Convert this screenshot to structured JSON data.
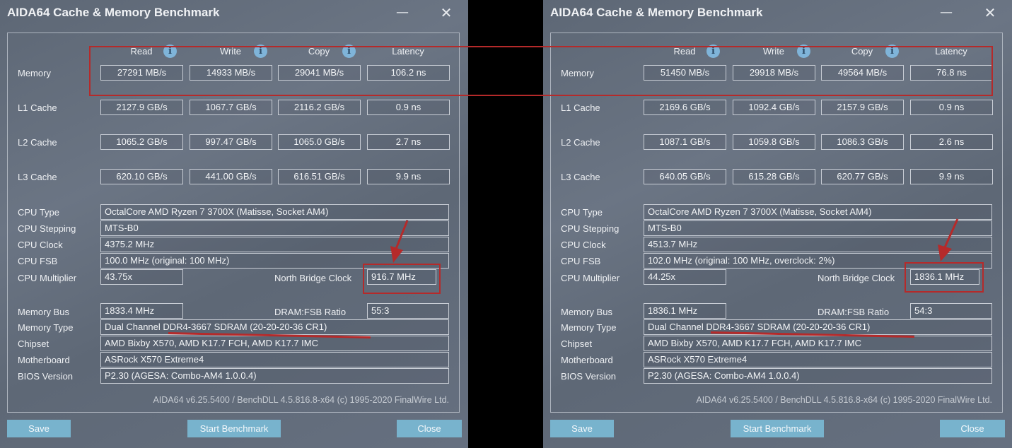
{
  "windows": [
    {
      "title": "AIDA64 Cache & Memory Benchmark",
      "headers": {
        "read": "Read",
        "write": "Write",
        "copy": "Copy",
        "latency": "Latency"
      },
      "rows": [
        {
          "label": "Memory",
          "read": "27291 MB/s",
          "write": "14933 MB/s",
          "copy": "29041 MB/s",
          "latency": "106.2 ns"
        },
        {
          "label": "L1 Cache",
          "read": "2127.9 GB/s",
          "write": "1067.7 GB/s",
          "copy": "2116.2 GB/s",
          "latency": "0.9 ns"
        },
        {
          "label": "L2 Cache",
          "read": "1065.2 GB/s",
          "write": "997.47 GB/s",
          "copy": "1065.0 GB/s",
          "latency": "2.7 ns"
        },
        {
          "label": "L3 Cache",
          "read": "620.10 GB/s",
          "write": "441.00 GB/s",
          "copy": "616.51 GB/s",
          "latency": "9.9 ns"
        }
      ],
      "cpu_type_label": "CPU Type",
      "cpu_type": "OctalCore AMD Ryzen 7 3700X  (Matisse, Socket AM4)",
      "cpu_stepping_label": "CPU Stepping",
      "cpu_stepping": "MTS-B0",
      "cpu_clock_label": "CPU Clock",
      "cpu_clock": "4375.2 MHz",
      "cpu_fsb_label": "CPU FSB",
      "cpu_fsb": "100.0 MHz  (original: 100 MHz)",
      "cpu_multiplier_label": "CPU Multiplier",
      "cpu_multiplier": "43.75x",
      "nb_clock_label": "North Bridge Clock",
      "nb_clock": "916.7 MHz",
      "memory_bus_label": "Memory Bus",
      "memory_bus": "1833.4 MHz",
      "dram_fsb_label": "DRAM:FSB Ratio",
      "dram_fsb": "55:3",
      "memory_type_label": "Memory Type",
      "memory_type": "Dual Channel DDR4-3667 SDRAM  (20-20-20-36 CR1)",
      "chipset_label": "Chipset",
      "chipset": "AMD Bixby X570, AMD K17.7 FCH, AMD K17.7 IMC",
      "motherboard_label": "Motherboard",
      "motherboard": "ASRock X570 Extreme4",
      "bios_label": "BIOS Version",
      "bios": "P2.30  (AGESA: Combo-AM4 1.0.0.4)",
      "footer": "AIDA64 v6.25.5400 / BenchDLL 4.5.816.8-x64  (c) 1995-2020 FinalWire Ltd.",
      "buttons": {
        "save": "Save",
        "start": "Start Benchmark",
        "close": "Close"
      }
    },
    {
      "title": "AIDA64 Cache & Memory Benchmark",
      "headers": {
        "read": "Read",
        "write": "Write",
        "copy": "Copy",
        "latency": "Latency"
      },
      "rows": [
        {
          "label": "Memory",
          "read": "51450 MB/s",
          "write": "29918 MB/s",
          "copy": "49564 MB/s",
          "latency": "76.8 ns"
        },
        {
          "label": "L1 Cache",
          "read": "2169.6 GB/s",
          "write": "1092.4 GB/s",
          "copy": "2157.9 GB/s",
          "latency": "0.9 ns"
        },
        {
          "label": "L2 Cache",
          "read": "1087.1 GB/s",
          "write": "1059.8 GB/s",
          "copy": "1086.3 GB/s",
          "latency": "2.6 ns"
        },
        {
          "label": "L3 Cache",
          "read": "640.05 GB/s",
          "write": "615.28 GB/s",
          "copy": "620.77 GB/s",
          "latency": "9.9 ns"
        }
      ],
      "cpu_type_label": "CPU Type",
      "cpu_type": "OctalCore AMD Ryzen 7 3700X  (Matisse, Socket AM4)",
      "cpu_stepping_label": "CPU Stepping",
      "cpu_stepping": "MTS-B0",
      "cpu_clock_label": "CPU Clock",
      "cpu_clock": "4513.7 MHz",
      "cpu_fsb_label": "CPU FSB",
      "cpu_fsb": "102.0 MHz  (original: 100 MHz, overclock: 2%)",
      "cpu_multiplier_label": "CPU Multiplier",
      "cpu_multiplier": "44.25x",
      "nb_clock_label": "North Bridge Clock",
      "nb_clock": "1836.1 MHz",
      "memory_bus_label": "Memory Bus",
      "memory_bus": "1836.1 MHz",
      "dram_fsb_label": "DRAM:FSB Ratio",
      "dram_fsb": "54:3",
      "memory_type_label": "Memory Type",
      "memory_type": "Dual Channel DDR4-3667 SDRAM  (20-20-20-36 CR1)",
      "chipset_label": "Chipset",
      "chipset": "AMD Bixby X570, AMD K17.7 FCH, AMD K17.7 IMC",
      "motherboard_label": "Motherboard",
      "motherboard": "ASRock X570 Extreme4",
      "bios_label": "BIOS Version",
      "bios": "P2.30  (AGESA: Combo-AM4 1.0.0.4)",
      "footer": "AIDA64 v6.25.5400 / BenchDLL 4.5.816.8-x64  (c) 1995-2020 FinalWire Ltd.",
      "buttons": {
        "save": "Save",
        "start": "Start Benchmark",
        "close": "Close"
      }
    }
  ],
  "icons": {
    "info": "info-icon",
    "minimize": "minimize-icon",
    "close": "close-icon"
  },
  "colors": {
    "annotation": "#b52a2a",
    "button": "#78b3cd",
    "info": "#7fb4d9"
  }
}
